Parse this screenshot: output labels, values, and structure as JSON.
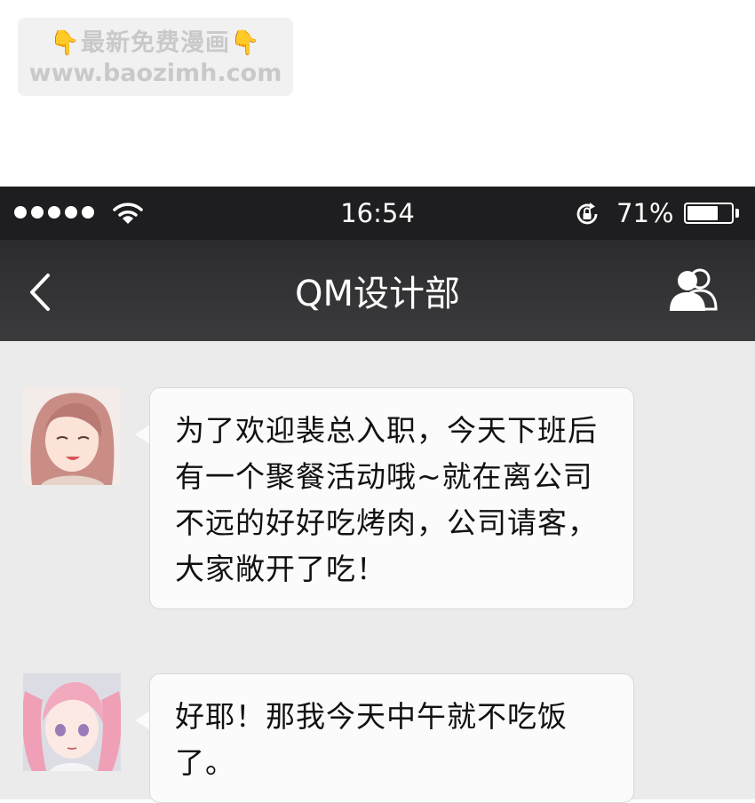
{
  "watermark": {
    "line1_left_icon": "pointing-down-hand",
    "line1_text": "最新免费漫画",
    "line1_right_icon": "pointing-down-hand",
    "line2_text": "www.baozimh.com"
  },
  "statusbar": {
    "signal_icon": "signal-dots",
    "wifi_icon": "wifi-icon",
    "time": "16:54",
    "rotation_lock_icon": "rotation-lock-icon",
    "battery_percent": "71%",
    "battery_level": 0.71
  },
  "navbar": {
    "back_icon": "chevron-left-icon",
    "title": "QM设计部",
    "members_icon": "group-icon"
  },
  "messages": [
    {
      "avatar": "avatar-long-hair",
      "text": "为了欢迎裴总入职，今天下班后有一个聚餐活动哦~就在离公司不远的好好吃烤肉，公司请客，大家敞开了吃！"
    },
    {
      "avatar": "avatar-pigtails",
      "text": "好耶！那我今天中午就不吃饭了。"
    }
  ],
  "colors": {
    "statusbar": "#1e1e20",
    "navbar": "#333335",
    "chat_background": "#ebebeb",
    "bubble": "#fbfbfb"
  }
}
